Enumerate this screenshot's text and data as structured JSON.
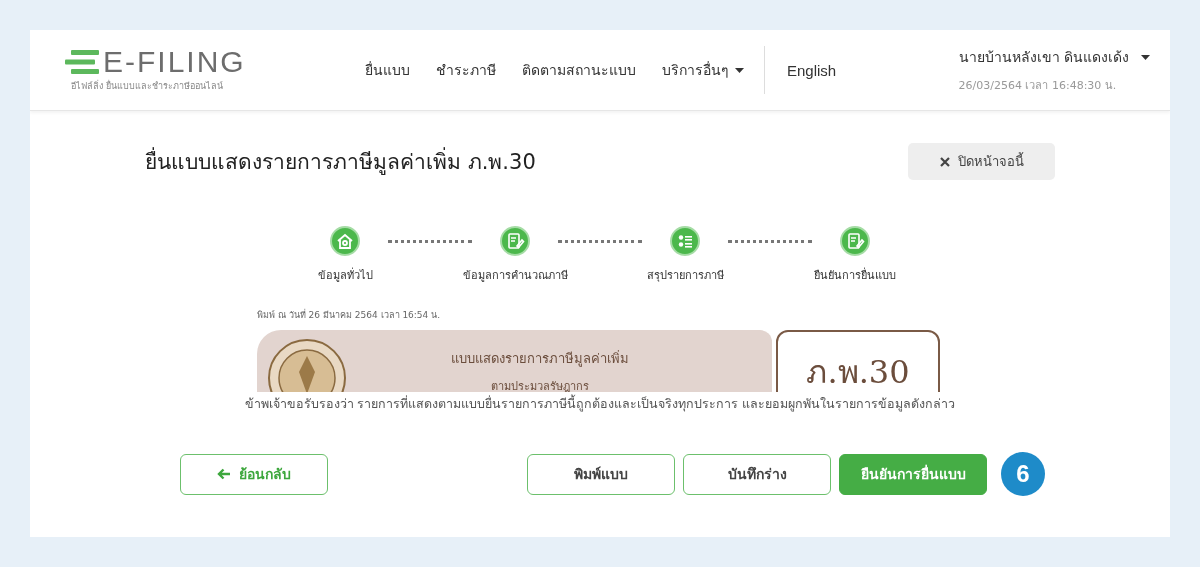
{
  "header": {
    "logo": "E-FILING",
    "tagline": "อีไฟล์ลิ่ง ยื่นแบบและชำระภาษีออนไลน์",
    "nav": [
      {
        "label": "ยื่นแบบ",
        "dropdown": false
      },
      {
        "label": "ชำระภาษี",
        "dropdown": false
      },
      {
        "label": "ติดตามสถานะแบบ",
        "dropdown": false
      },
      {
        "label": "บริการอื่นๆ",
        "dropdown": true
      }
    ],
    "language": "English",
    "user": "นายบ้านหลังเขา ดินแดงเด้ง",
    "datetime": "26/03/2564 เวลา 16:48:30 น."
  },
  "page": {
    "title": "ยื่นแบบแสดงรายการภาษีมูลค่าเพิ่ม ภ.พ.30",
    "close_button": "ปิดหน้าจอนี้"
  },
  "steps": [
    {
      "label": "ข้อมูลทั่วไป"
    },
    {
      "label": "ข้อมูลการคำนวณภาษี"
    },
    {
      "label": "สรุปรายการภาษี"
    },
    {
      "label": "ยืนยันการยื่นแบบ"
    }
  ],
  "preview": {
    "printed": "พิมพ์ ณ วันที่ 26 มีนาคม 2564  เวลา 16:54 น.",
    "heading": "แบบแสดงรายการภาษีมูลค่าเพิ่ม",
    "subheading": "ตามประมวลรัษฎากร",
    "form_code": "ภ.พ.30"
  },
  "declaration": "ข้าพเจ้าขอรับรองว่า รายการที่แสดงตามแบบยื่นรายการภาษีนี้ถูกต้องและเป็นจริงทุกประการ และยอมผูกพันในรายการข้อมูลดังกล่าว",
  "buttons": [
    {
      "label": "ย้อนกลับ",
      "kind": "back"
    },
    {
      "label": "พิมพ์แบบ",
      "kind": "outline"
    },
    {
      "label": "บันทึกร่าง",
      "kind": "outline"
    },
    {
      "label": "ยืนยันการยื่นแบบ",
      "kind": "primary"
    }
  ],
  "step_badge": "6"
}
